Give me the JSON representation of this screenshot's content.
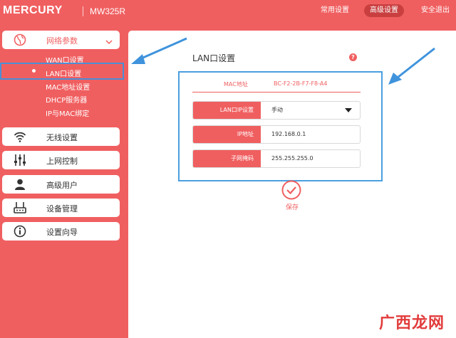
{
  "header": {
    "brand": "MERCURY",
    "model": "MW325R",
    "nav": [
      "常用设置",
      "高级设置",
      "安全退出"
    ]
  },
  "sidebar": {
    "group_network": {
      "label": "网络参数",
      "icon": "globe-icon"
    },
    "sub_items": [
      "WAN口设置",
      "LAN口设置",
      "MAC地址设置",
      "DHCP服务器",
      "IP与MAC绑定"
    ],
    "items": [
      {
        "label": "无线设置",
        "icon": "wifi-icon"
      },
      {
        "label": "上网控制",
        "icon": "sliders-icon"
      },
      {
        "label": "高级用户",
        "icon": "user-icon"
      },
      {
        "label": "设备管理",
        "icon": "router-icon"
      },
      {
        "label": "设置向导",
        "icon": "info-icon"
      }
    ]
  },
  "main": {
    "title": "LAN口设置",
    "mac_label": "MAC地址",
    "mac_value": "BC-F2-2B-F7-F8-A4",
    "fields": [
      {
        "label": "LAN口IP设置",
        "value": "手动"
      },
      {
        "label": "IP地址",
        "value": "192.168.0.1"
      },
      {
        "label": "子网掩码",
        "value": "255.255.255.0"
      }
    ],
    "save_label": "保存"
  },
  "watermark": "广西龙网",
  "colors": {
    "brand_red": "#f05f60",
    "highlight_blue": "#4a9fe0"
  }
}
